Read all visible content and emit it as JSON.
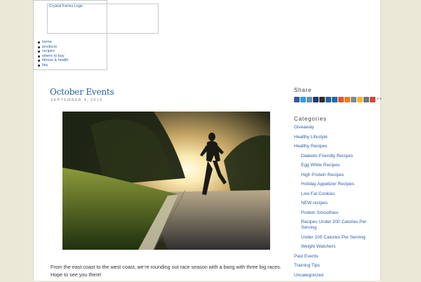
{
  "header": {
    "logo_alt": "Crystal Farms Logo",
    "nav": [
      "home",
      "products",
      "recipes",
      "where to buy",
      "fitness & health",
      "faq"
    ]
  },
  "post": {
    "title": "October Events",
    "date": "SEPTEMBER 4, 2014",
    "image_subject": "runner on road at sunset",
    "excerpt": "From the east coast to the west coast, we’re rounding out race season with a bang with three big races. Hope to see you there!"
  },
  "sidebar": {
    "share_heading": "Share",
    "share_more": "++",
    "share_icons": [
      {
        "name": "facebook-icon",
        "color": "#3b5998"
      },
      {
        "name": "twitter-icon",
        "color": "#2fa0d8"
      },
      {
        "name": "email-icon",
        "color": "#6b8fb3"
      },
      {
        "name": "myspace-icon",
        "color": "#1f3b6e"
      },
      {
        "name": "delicious-icon",
        "color": "#2e2e2e"
      },
      {
        "name": "digg-icon",
        "color": "#2c62a8"
      },
      {
        "name": "linkedin-icon",
        "color": "#1a6fa8"
      },
      {
        "name": "stumbleupon-icon",
        "color": "#e8562c"
      },
      {
        "name": "blogger-icon",
        "color": "#f07c1f"
      },
      {
        "name": "mail-icon",
        "color": "#7b8a96"
      },
      {
        "name": "favorites-icon",
        "color": "#f0b62a"
      },
      {
        "name": "print-icon",
        "color": "#6c7883"
      },
      {
        "name": "googleplus-icon",
        "color": "#d14836"
      }
    ],
    "categories_heading": "Categories",
    "categories": [
      {
        "label": "Giveaway",
        "level": 0
      },
      {
        "label": "Healthy Lifestyle",
        "level": 0
      },
      {
        "label": "Healthy Recipes",
        "level": 0
      },
      {
        "label": "Diabetic-Friendly Recipes",
        "level": 1
      },
      {
        "label": "Egg White Recipes",
        "level": 1
      },
      {
        "label": "High Protein Recipes",
        "level": 1
      },
      {
        "label": "Holiday Appetizer Recipes",
        "level": 1
      },
      {
        "label": "Low Fat Cookies",
        "level": 1
      },
      {
        "label": "NEW recipes",
        "level": 1
      },
      {
        "label": "Protein Smoothies",
        "level": 1
      },
      {
        "label": "Recipes Under 200 Calories Per Serving",
        "level": 1
      },
      {
        "label": "Under 100 Calories Per Serving",
        "level": 1
      },
      {
        "label": "Weight Watchers",
        "level": 1
      },
      {
        "label": "Past Events",
        "level": 0
      },
      {
        "label": "Training Tips",
        "level": 0
      },
      {
        "label": "Uncategorized",
        "level": 0
      }
    ]
  }
}
